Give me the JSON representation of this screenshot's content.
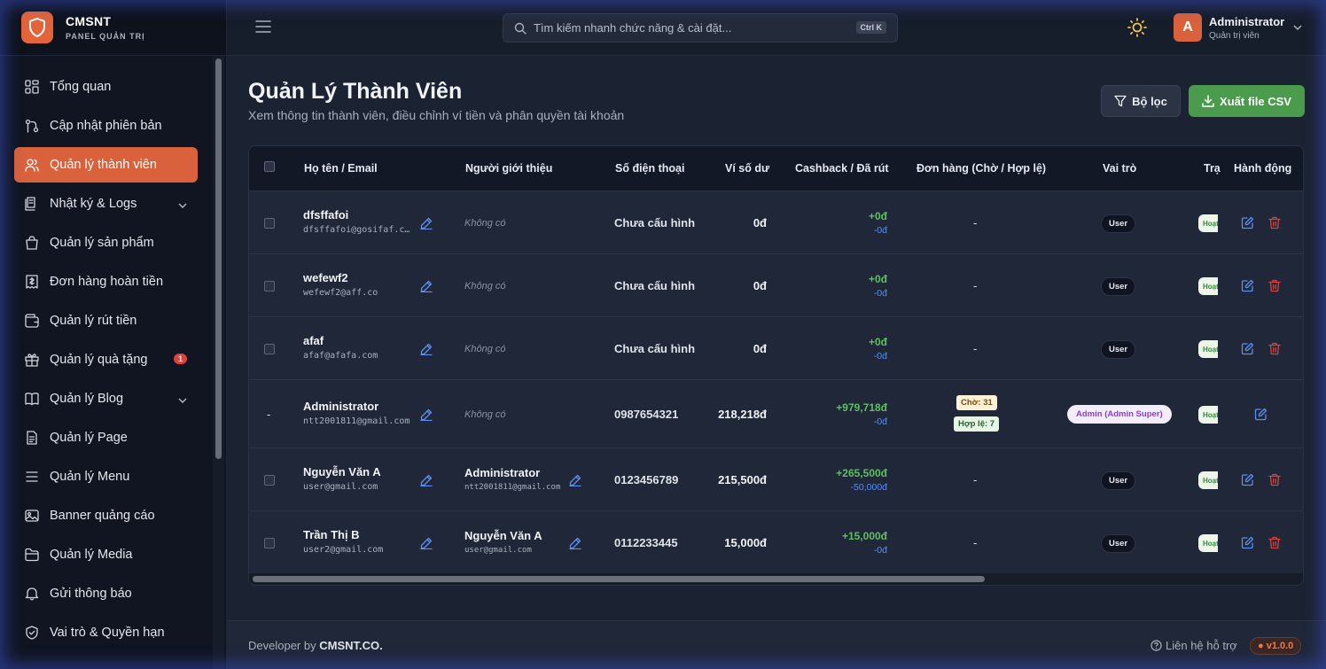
{
  "brand": {
    "name": "CMSNT",
    "subtitle": "PANEL QUẢN TRỊ"
  },
  "sidebar": {
    "items": [
      {
        "label": "Tổng quan",
        "icon": "dashboard-icon"
      },
      {
        "label": "Cập nhật phiên bản",
        "icon": "git-icon"
      },
      {
        "label": "Quản lý thành viên",
        "icon": "users-icon",
        "active": true
      },
      {
        "label": "Nhật ký & Logs",
        "icon": "logs-icon",
        "expandable": true
      },
      {
        "label": "Quản lý sản phẩm",
        "icon": "shopping-bag-icon"
      },
      {
        "label": "Đơn hàng hoàn tiền",
        "icon": "receipt-icon"
      },
      {
        "label": "Quản lý rút tiền",
        "icon": "wallet-icon"
      },
      {
        "label": "Quản lý quà tặng",
        "icon": "gift-icon",
        "badge": "1"
      },
      {
        "label": "Quản lý Blog",
        "icon": "book-icon",
        "expandable": true
      },
      {
        "label": "Quản lý Page",
        "icon": "page-icon"
      },
      {
        "label": "Quản lý Menu",
        "icon": "menu-icon"
      },
      {
        "label": "Banner quảng cáo",
        "icon": "image-icon"
      },
      {
        "label": "Quản lý Media",
        "icon": "folder-icon"
      },
      {
        "label": "Gửi thông báo",
        "icon": "bell-icon"
      },
      {
        "label": "Vai trò & Quyền hạn",
        "icon": "shield-icon"
      }
    ]
  },
  "header": {
    "search_placeholder": "Tìm kiếm nhanh chức năng & cài đặt...",
    "search_shortcut": "Ctrl K",
    "user": {
      "initial": "A",
      "name": "Administrator",
      "role": "Quản trị viên"
    }
  },
  "page": {
    "title": "Quản Lý Thành Viên",
    "subtitle": "Xem thông tin thành viên, điều chỉnh ví tiền và phân quyền tài khoản",
    "filter_label": "Bộ lọc",
    "export_label": "Xuất file CSV"
  },
  "table": {
    "columns": [
      "Họ tên / Email",
      "Người giới thiệu",
      "Số điện thoại",
      "Ví số dư",
      "Cashback / Đã rút",
      "Đơn hàng (Chờ / Hợp lệ)",
      "Vai trò",
      "Trạ",
      "Hành động"
    ],
    "rows": [
      {
        "name": "dfsffafoi",
        "email": "dfsffafoi@gosifaf.c…",
        "referrer_name": "",
        "referrer_email": "",
        "referrer": "Không có",
        "phone": "Chưa cấu hình",
        "wallet": "0đ",
        "cashback": "+0đ",
        "withdrawn": "-0đ",
        "orders": "-",
        "role": "User",
        "status": "Hoạt"
      },
      {
        "name": "wefewf2",
        "email": "wefewf2@aff.co",
        "referrer_name": "",
        "referrer_email": "",
        "referrer": "Không có",
        "phone": "Chưa cấu hình",
        "wallet": "0đ",
        "cashback": "+0đ",
        "withdrawn": "-0đ",
        "orders": "-",
        "role": "User",
        "status": "Hoạt"
      },
      {
        "name": "afaf",
        "email": "afaf@afafa.com",
        "referrer_name": "",
        "referrer_email": "",
        "referrer": "Không có",
        "phone": "Chưa cấu hình",
        "wallet": "0đ",
        "cashback": "+0đ",
        "withdrawn": "-0đ",
        "orders": "-",
        "role": "User",
        "status": "Hoạt"
      },
      {
        "name": "Administrator",
        "email": "ntt2001811@gmail.com",
        "referrer_name": "",
        "referrer_email": "",
        "referrer": "Không có",
        "phone": "0987654321",
        "wallet": "218,218đ",
        "cashback": "+979,718đ",
        "withdrawn": "-0đ",
        "orders_wait": "Chờ: 31",
        "orders_ok": "Hợp lệ: 7",
        "role": "Admin (Admin Super)",
        "status": "Hoạt",
        "row_marker": "-"
      },
      {
        "name": "Nguyễn Văn A",
        "email": "user@gmail.com",
        "referrer_name": "Administrator",
        "referrer_email": "ntt2001811@gmail.com",
        "referrer": "",
        "phone": "0123456789",
        "wallet": "215,500đ",
        "cashback": "+265,500đ",
        "withdrawn": "-50,000đ",
        "orders": "-",
        "role": "User",
        "status": "Hoạt"
      },
      {
        "name": "Trần Thị B",
        "email": "user2@gmail.com",
        "referrer_name": "Nguyễn Văn A",
        "referrer_email": "user@gmail.com",
        "referrer": "",
        "phone": "0112233445",
        "wallet": "15,000đ",
        "cashback": "+15,000đ",
        "withdrawn": "-0đ",
        "orders": "-",
        "role": "User",
        "status": "Hoạt"
      }
    ]
  },
  "footer": {
    "developer_prefix": "Developer by",
    "developer_name": "CMSNT.CO.",
    "help": "Liên hệ hỗ trợ",
    "version": "v1.0.0"
  },
  "colors": {
    "accent": "#d9613b",
    "success": "#4a9b4c",
    "danger": "#d9433b",
    "link": "#5b8ff0"
  }
}
